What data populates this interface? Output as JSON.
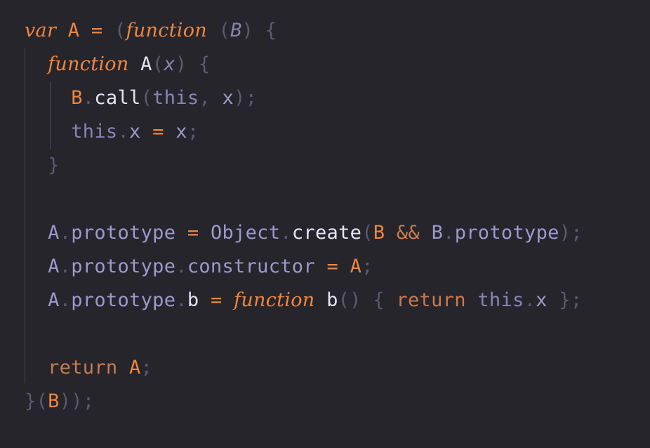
{
  "editor": {
    "background": "#26252c",
    "colors": {
      "keyword": "#f0863f",
      "identifier": "#9d99cc",
      "punctuation": "#5c5970",
      "method": "#e6e4f5"
    },
    "lines": [
      [
        {
          "t": "var",
          "c": "kw"
        },
        {
          "t": " ",
          "c": "punc"
        },
        {
          "t": "A",
          "c": "ident-or"
        },
        {
          "t": " ",
          "c": "punc"
        },
        {
          "t": "=",
          "c": "op"
        },
        {
          "t": " ",
          "c": "punc"
        },
        {
          "t": "(",
          "c": "punc"
        },
        {
          "t": "function",
          "c": "kw"
        },
        {
          "t": " ",
          "c": "punc"
        },
        {
          "t": "(",
          "c": "punc"
        },
        {
          "t": "B",
          "c": "param"
        },
        {
          "t": ")",
          "c": "punc"
        },
        {
          "t": " ",
          "c": "punc"
        },
        {
          "t": "{",
          "c": "punc"
        }
      ],
      [
        {
          "t": "  ",
          "c": "punc"
        },
        {
          "t": "function",
          "c": "kw"
        },
        {
          "t": " ",
          "c": "punc"
        },
        {
          "t": "A",
          "c": "ident-w"
        },
        {
          "t": "(",
          "c": "punc"
        },
        {
          "t": "x",
          "c": "param"
        },
        {
          "t": ")",
          "c": "punc"
        },
        {
          "t": " ",
          "c": "punc"
        },
        {
          "t": "{",
          "c": "punc"
        }
      ],
      [
        {
          "t": "    ",
          "c": "punc"
        },
        {
          "t": "B",
          "c": "ident-or"
        },
        {
          "t": ".",
          "c": "punc"
        },
        {
          "t": "call",
          "c": "ident-w"
        },
        {
          "t": "(",
          "c": "punc"
        },
        {
          "t": "this",
          "c": "this"
        },
        {
          "t": ",",
          "c": "punc"
        },
        {
          "t": " ",
          "c": "punc"
        },
        {
          "t": "x",
          "c": "ident"
        },
        {
          "t": ")",
          "c": "punc"
        },
        {
          "t": ";",
          "c": "punc"
        }
      ],
      [
        {
          "t": "    ",
          "c": "punc"
        },
        {
          "t": "this",
          "c": "this"
        },
        {
          "t": ".",
          "c": "punc"
        },
        {
          "t": "x",
          "c": "ident"
        },
        {
          "t": " ",
          "c": "punc"
        },
        {
          "t": "=",
          "c": "op"
        },
        {
          "t": " ",
          "c": "punc"
        },
        {
          "t": "x",
          "c": "ident"
        },
        {
          "t": ";",
          "c": "punc"
        }
      ],
      [
        {
          "t": "  ",
          "c": "punc"
        },
        {
          "t": "}",
          "c": "punc"
        }
      ],
      [],
      [
        {
          "t": "  ",
          "c": "punc"
        },
        {
          "t": "A",
          "c": "ident"
        },
        {
          "t": ".",
          "c": "punc"
        },
        {
          "t": "prototype",
          "c": "ident"
        },
        {
          "t": " ",
          "c": "punc"
        },
        {
          "t": "=",
          "c": "op"
        },
        {
          "t": " ",
          "c": "punc"
        },
        {
          "t": "Object",
          "c": "ident"
        },
        {
          "t": ".",
          "c": "punc"
        },
        {
          "t": "create",
          "c": "ident-w"
        },
        {
          "t": "(",
          "c": "punc"
        },
        {
          "t": "B",
          "c": "ident-or"
        },
        {
          "t": " ",
          "c": "punc"
        },
        {
          "t": "&&",
          "c": "kwplain"
        },
        {
          "t": " ",
          "c": "punc"
        },
        {
          "t": "B",
          "c": "ident"
        },
        {
          "t": ".",
          "c": "punc"
        },
        {
          "t": "prototype",
          "c": "ident"
        },
        {
          "t": ")",
          "c": "punc"
        },
        {
          "t": ";",
          "c": "punc"
        }
      ],
      [
        {
          "t": "  ",
          "c": "punc"
        },
        {
          "t": "A",
          "c": "ident"
        },
        {
          "t": ".",
          "c": "punc"
        },
        {
          "t": "prototype",
          "c": "ident"
        },
        {
          "t": ".",
          "c": "punc"
        },
        {
          "t": "constructor",
          "c": "ident"
        },
        {
          "t": " ",
          "c": "punc"
        },
        {
          "t": "=",
          "c": "op"
        },
        {
          "t": " ",
          "c": "punc"
        },
        {
          "t": "A",
          "c": "ident-or"
        },
        {
          "t": ";",
          "c": "punc"
        }
      ],
      [
        {
          "t": "  ",
          "c": "punc"
        },
        {
          "t": "A",
          "c": "ident"
        },
        {
          "t": ".",
          "c": "punc"
        },
        {
          "t": "prototype",
          "c": "ident"
        },
        {
          "t": ".",
          "c": "punc"
        },
        {
          "t": "b",
          "c": "ident-w"
        },
        {
          "t": " ",
          "c": "punc"
        },
        {
          "t": "=",
          "c": "op"
        },
        {
          "t": " ",
          "c": "punc"
        },
        {
          "t": "function",
          "c": "kw"
        },
        {
          "t": " ",
          "c": "punc"
        },
        {
          "t": "b",
          "c": "ident-w"
        },
        {
          "t": "()",
          "c": "punc"
        },
        {
          "t": " ",
          "c": "punc"
        },
        {
          "t": "{",
          "c": "punc"
        },
        {
          "t": " ",
          "c": "punc"
        },
        {
          "t": "return",
          "c": "kwplain"
        },
        {
          "t": " ",
          "c": "punc"
        },
        {
          "t": "this",
          "c": "this"
        },
        {
          "t": ".",
          "c": "punc"
        },
        {
          "t": "x",
          "c": "ident"
        },
        {
          "t": " ",
          "c": "punc"
        },
        {
          "t": "}",
          "c": "punc"
        },
        {
          "t": ";",
          "c": "punc"
        }
      ],
      [],
      [
        {
          "t": "  ",
          "c": "punc"
        },
        {
          "t": "return",
          "c": "kwplain"
        },
        {
          "t": " ",
          "c": "punc"
        },
        {
          "t": "A",
          "c": "ident-or"
        },
        {
          "t": ";",
          "c": "punc"
        }
      ],
      [
        {
          "t": "}",
          "c": "punc"
        },
        {
          "t": "(",
          "c": "punc"
        },
        {
          "t": "B",
          "c": "ident-or"
        },
        {
          "t": "))",
          "c": "punc"
        },
        {
          "t": ";",
          "c": "punc"
        }
      ]
    ]
  }
}
